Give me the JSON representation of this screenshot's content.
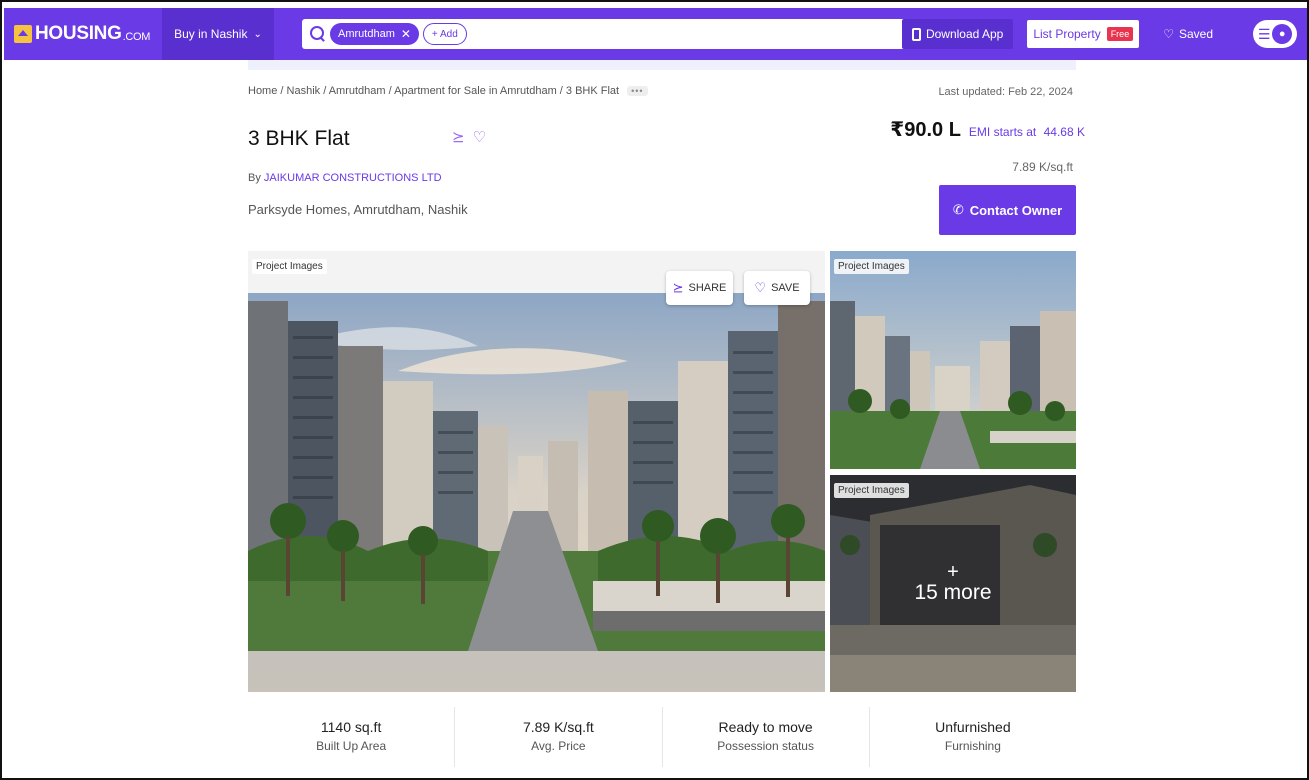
{
  "brand": {
    "name": "HOUSING",
    "suffix": ".COM"
  },
  "nav": {
    "city": "Buy in Nashik",
    "search": {
      "chip": "Amrutdham",
      "add": "+ Add"
    },
    "download_app": "Download App",
    "list_property": "List Property",
    "free_badge": "Free",
    "saved": "Saved"
  },
  "breadcrumb": "Home / Nashik / Amrutdham / Apartment for Sale in Amrutdham / 3 BHK Flat",
  "last_updated": "Last updated: Feb 22, 2024",
  "listing": {
    "title": "3 BHK Flat",
    "builder_prefix": "By",
    "builder": "JAIKUMAR CONSTRUCTIONS LTD",
    "locality": "Parksyde Homes, Amrutdham, Nashik",
    "price": "₹90.0 L",
    "emi_label": "EMI starts at",
    "emi_value": "44.68 K",
    "price_per_sqft": "7.89 K/sq.ft",
    "contact_label": "Contact Owner"
  },
  "gallery": {
    "label": "Project Images",
    "share": "SHARE",
    "save": "SAVE",
    "more_count": "15 more"
  },
  "stats": [
    {
      "value": "1140 sq.ft",
      "label": "Built Up Area"
    },
    {
      "value": "7.89 K/sq.ft",
      "label": "Avg. Price"
    },
    {
      "value": "Ready to move",
      "label": "Possession status"
    },
    {
      "value": "Unfurnished",
      "label": "Furnishing"
    }
  ],
  "colors": {
    "brand": "#6a3ae6",
    "logo_mark": "#f6c341",
    "free_badge": "#e8344e"
  }
}
